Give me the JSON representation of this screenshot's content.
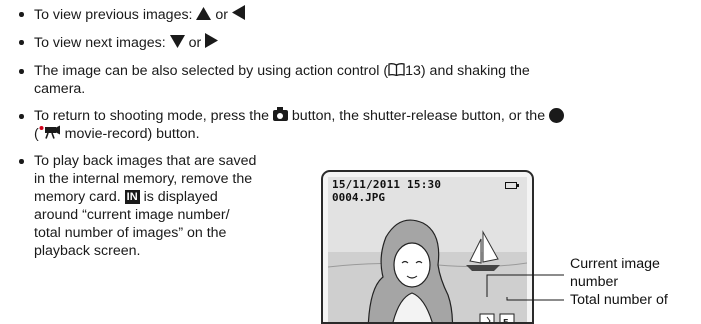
{
  "bullets": {
    "prev": {
      "text": "To view previous images: ",
      "sep": " or "
    },
    "next": {
      "text": "To view next images: ",
      "sep": " or "
    },
    "action": {
      "line1_pre": "The image can be also selected by using action control (",
      "page_ref": "13",
      "line1_post": ") and shaking the",
      "line2": "camera."
    },
    "shoot": {
      "line1_pre": "To return to shooting mode, press the ",
      "line1_post": " button, the shutter-release button, or the ",
      "line2_pre": "(",
      "line2_post": " movie-record) button."
    },
    "internal": {
      "lines": [
        "To play back images that are saved",
        "in the internal memory, remove the",
        "memory card. ",
        "around “current image number/",
        "total number of images” on the",
        "playback screen."
      ],
      "icon_label": "IN",
      "line3_post": " is displayed"
    }
  },
  "screen": {
    "datetime": "15/11/2011 15:30",
    "filename": "0004.JPG"
  },
  "callouts": {
    "current_line1": "Current image",
    "current_line2": "number",
    "total": "Total number of"
  },
  "icons": {
    "up": "triangle-up-icon",
    "left": "triangle-left-icon",
    "down": "triangle-down-icon",
    "right": "triangle-right-icon",
    "book": "book-reference-icon",
    "camera": "camera-button-icon",
    "record": "movie-record-dot-icon",
    "movie": "movie-camera-icon",
    "memory": "internal-memory-icon",
    "battery": "battery-icon"
  }
}
